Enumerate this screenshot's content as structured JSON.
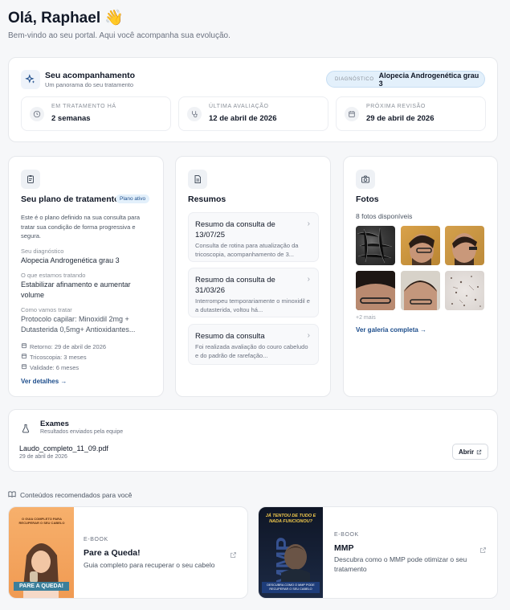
{
  "header": {
    "greeting": "Olá, Raphael",
    "wave": "👋",
    "subtitle": "Bem-vindo ao seu portal. Aqui você acompanha sua evolução."
  },
  "tracking": {
    "title": "Seu acompanhamento",
    "subtitle": "Um panorama do seu tratamento",
    "diagnosis_label": "DIAGNÓSTICO",
    "diagnosis_value": "Alopecia Androgenética grau 3",
    "stats": [
      {
        "label": "EM TRATAMENTO HÁ",
        "value": "2 semanas"
      },
      {
        "label": "ÚLTIMA AVALIAÇÃO",
        "value": "12 de abril de 2026"
      },
      {
        "label": "PRÓXIMA REVISÃO",
        "value": "29 de abril de 2026"
      }
    ]
  },
  "plan": {
    "title": "Seu plano de tratamento",
    "badge": "Plano ativo",
    "description": "Este é o plano definido na sua consulta para tratar sua condição de forma progressiva e segura.",
    "diagnosis_label": "Seu diagnóstico",
    "diagnosis_value": "Alopecia Androgenética grau 3",
    "treating_label": "O que estamos tratando",
    "treating_value": "Estabilizar afinamento e aumentar volume",
    "how_label": "Como vamos tratar",
    "how_value": "Protocolo capilar: Minoxidil 2mg + Dutasterida 0,5mg+ Antioxidantes...",
    "return": "Retorno: 29 de abril de 2026",
    "tricoscopia": "Tricoscopia: 3 meses",
    "validity": "Validade: 6 meses",
    "details_link": "Ver detalhes →"
  },
  "summaries": {
    "title": "Resumos",
    "items": [
      {
        "title": "Resumo da consulta de 13/07/25",
        "desc": "Consulta de rotina para atualização da tricoscopia, acompanhamento de 3..."
      },
      {
        "title": "Resumo da consulta de 31/03/26",
        "desc": "Interrompeu temporariamente o minoxidil e a dutasterida, voltou há..."
      },
      {
        "title": "Resumo da consulta",
        "desc": "Foi realizada avaliação do couro cabeludo e do padrão de rarefação..."
      }
    ]
  },
  "photos": {
    "title": "Fotos",
    "count": "8 fotos disponíveis",
    "more": "+2 mais",
    "gallery_link": "Ver galeria completa →"
  },
  "exams": {
    "title": "Exames",
    "subtitle": "Resultados enviados pela equipe",
    "file_name": "Laudo_completo_11_09.pdf",
    "file_date": "29 de abril de 2026",
    "open_label": "Abrir"
  },
  "recommended": {
    "title": "Conteúdos recomendados para você",
    "items": [
      {
        "type": "E-BOOK",
        "title": "Pare a Queda!",
        "desc": "Guia completo para recuperar o seu cabelo",
        "cover_top": "O GUIA COMPLETO PARA RECUPERAR O SEU CABELO",
        "cover_bottom": "PARE A QUEDA!"
      },
      {
        "type": "E-BOOK",
        "title": "MMP",
        "desc": "Descubra como o MMP pode otimizar o seu tratamento",
        "cover_top": "JÁ TENTOU DE TUDO E NADA FUNCIONOU?",
        "cover_mid": "MMP",
        "cover_bottom": "DESCUBRA COMO O MMP PODE RECUPERAR O SEU CABELO"
      }
    ]
  },
  "colors": {
    "accent": "#1e4e8c",
    "badge_bg": "#e3f0fb",
    "orange_cover": "#f4a35f",
    "dark_cover": "#0f1626"
  }
}
